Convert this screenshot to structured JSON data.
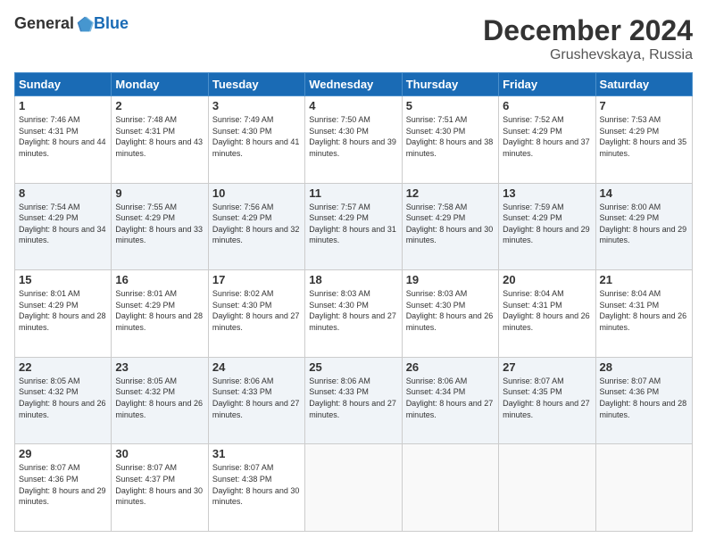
{
  "header": {
    "logo_general": "General",
    "logo_blue": "Blue",
    "month_title": "December 2024",
    "location": "Grushevskaya, Russia"
  },
  "days_of_week": [
    "Sunday",
    "Monday",
    "Tuesday",
    "Wednesday",
    "Thursday",
    "Friday",
    "Saturday"
  ],
  "weeks": [
    [
      {
        "day": "1",
        "sunrise": "7:46 AM",
        "sunset": "4:31 PM",
        "daylight": "8 hours and 44 minutes."
      },
      {
        "day": "2",
        "sunrise": "7:48 AM",
        "sunset": "4:31 PM",
        "daylight": "8 hours and 43 minutes."
      },
      {
        "day": "3",
        "sunrise": "7:49 AM",
        "sunset": "4:30 PM",
        "daylight": "8 hours and 41 minutes."
      },
      {
        "day": "4",
        "sunrise": "7:50 AM",
        "sunset": "4:30 PM",
        "daylight": "8 hours and 39 minutes."
      },
      {
        "day": "5",
        "sunrise": "7:51 AM",
        "sunset": "4:30 PM",
        "daylight": "8 hours and 38 minutes."
      },
      {
        "day": "6",
        "sunrise": "7:52 AM",
        "sunset": "4:29 PM",
        "daylight": "8 hours and 37 minutes."
      },
      {
        "day": "7",
        "sunrise": "7:53 AM",
        "sunset": "4:29 PM",
        "daylight": "8 hours and 35 minutes."
      }
    ],
    [
      {
        "day": "8",
        "sunrise": "7:54 AM",
        "sunset": "4:29 PM",
        "daylight": "8 hours and 34 minutes."
      },
      {
        "day": "9",
        "sunrise": "7:55 AM",
        "sunset": "4:29 PM",
        "daylight": "8 hours and 33 minutes."
      },
      {
        "day": "10",
        "sunrise": "7:56 AM",
        "sunset": "4:29 PM",
        "daylight": "8 hours and 32 minutes."
      },
      {
        "day": "11",
        "sunrise": "7:57 AM",
        "sunset": "4:29 PM",
        "daylight": "8 hours and 31 minutes."
      },
      {
        "day": "12",
        "sunrise": "7:58 AM",
        "sunset": "4:29 PM",
        "daylight": "8 hours and 30 minutes."
      },
      {
        "day": "13",
        "sunrise": "7:59 AM",
        "sunset": "4:29 PM",
        "daylight": "8 hours and 29 minutes."
      },
      {
        "day": "14",
        "sunrise": "8:00 AM",
        "sunset": "4:29 PM",
        "daylight": "8 hours and 29 minutes."
      }
    ],
    [
      {
        "day": "15",
        "sunrise": "8:01 AM",
        "sunset": "4:29 PM",
        "daylight": "8 hours and 28 minutes."
      },
      {
        "day": "16",
        "sunrise": "8:01 AM",
        "sunset": "4:29 PM",
        "daylight": "8 hours and 28 minutes."
      },
      {
        "day": "17",
        "sunrise": "8:02 AM",
        "sunset": "4:30 PM",
        "daylight": "8 hours and 27 minutes."
      },
      {
        "day": "18",
        "sunrise": "8:03 AM",
        "sunset": "4:30 PM",
        "daylight": "8 hours and 27 minutes."
      },
      {
        "day": "19",
        "sunrise": "8:03 AM",
        "sunset": "4:30 PM",
        "daylight": "8 hours and 26 minutes."
      },
      {
        "day": "20",
        "sunrise": "8:04 AM",
        "sunset": "4:31 PM",
        "daylight": "8 hours and 26 minutes."
      },
      {
        "day": "21",
        "sunrise": "8:04 AM",
        "sunset": "4:31 PM",
        "daylight": "8 hours and 26 minutes."
      }
    ],
    [
      {
        "day": "22",
        "sunrise": "8:05 AM",
        "sunset": "4:32 PM",
        "daylight": "8 hours and 26 minutes."
      },
      {
        "day": "23",
        "sunrise": "8:05 AM",
        "sunset": "4:32 PM",
        "daylight": "8 hours and 26 minutes."
      },
      {
        "day": "24",
        "sunrise": "8:06 AM",
        "sunset": "4:33 PM",
        "daylight": "8 hours and 27 minutes."
      },
      {
        "day": "25",
        "sunrise": "8:06 AM",
        "sunset": "4:33 PM",
        "daylight": "8 hours and 27 minutes."
      },
      {
        "day": "26",
        "sunrise": "8:06 AM",
        "sunset": "4:34 PM",
        "daylight": "8 hours and 27 minutes."
      },
      {
        "day": "27",
        "sunrise": "8:07 AM",
        "sunset": "4:35 PM",
        "daylight": "8 hours and 27 minutes."
      },
      {
        "day": "28",
        "sunrise": "8:07 AM",
        "sunset": "4:36 PM",
        "daylight": "8 hours and 28 minutes."
      }
    ],
    [
      {
        "day": "29",
        "sunrise": "8:07 AM",
        "sunset": "4:36 PM",
        "daylight": "8 hours and 29 minutes."
      },
      {
        "day": "30",
        "sunrise": "8:07 AM",
        "sunset": "4:37 PM",
        "daylight": "8 hours and 30 minutes."
      },
      {
        "day": "31",
        "sunrise": "8:07 AM",
        "sunset": "4:38 PM",
        "daylight": "8 hours and 30 minutes."
      },
      null,
      null,
      null,
      null
    ]
  ],
  "labels": {
    "sunrise": "Sunrise:",
    "sunset": "Sunset:",
    "daylight": "Daylight:"
  }
}
